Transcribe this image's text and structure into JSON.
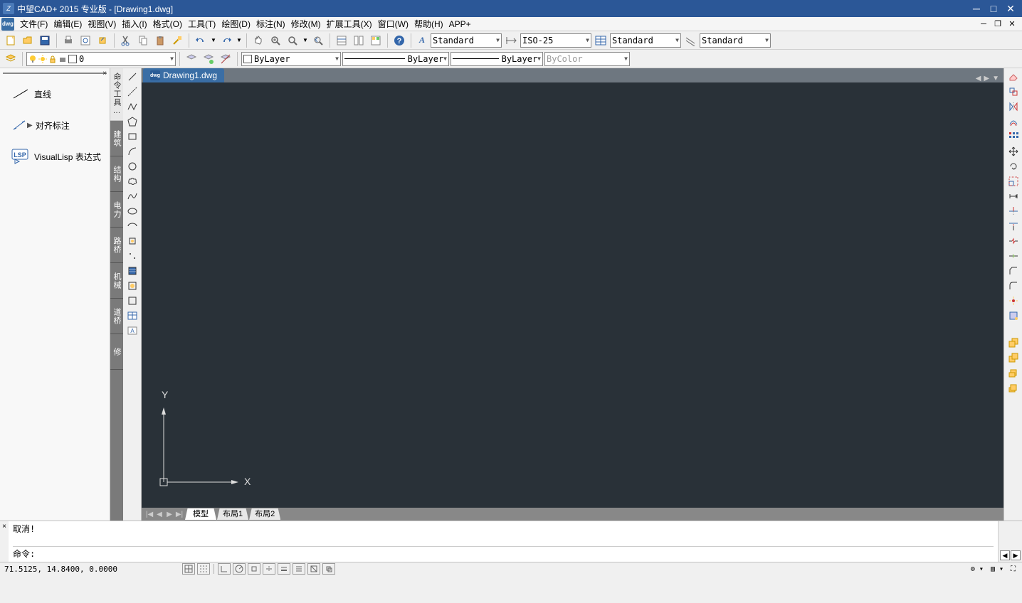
{
  "title": "中望CAD+ 2015 专业版 - [Drawing1.dwg]",
  "menus": [
    "文件(F)",
    "编辑(E)",
    "视图(V)",
    "插入(I)",
    "格式(O)",
    "工具(T)",
    "绘图(D)",
    "标注(N)",
    "修改(M)",
    "扩展工具(X)",
    "窗口(W)",
    "帮助(H)",
    "APP+"
  ],
  "row1_dropdowns": {
    "text_style": "Standard",
    "dim_style": "ISO-25",
    "table_style": "Standard",
    "mline_style": "Standard"
  },
  "layer_dropdown": "0",
  "row2_dropdowns": {
    "color": "ByLayer",
    "linetype": "ByLayer",
    "lineweight": "ByLayer",
    "plot_style": "ByColor"
  },
  "left_panel": {
    "items": [
      {
        "label": "直线"
      },
      {
        "label": "对齐标注"
      },
      {
        "label": "VisualLisp 表达式"
      }
    ]
  },
  "vtabs": [
    "命令工具…",
    "建筑",
    "结构",
    "电力",
    "路桥",
    "机械",
    "道桥",
    "修"
  ],
  "doc_tab": "Drawing1.dwg",
  "view_tabs": [
    "模型",
    "布局1",
    "布局2"
  ],
  "cmd_cancel": "取消!",
  "cmd_prompt": "命令:",
  "coords": "71.5125,  14.8400, 0.0000",
  "ucs": {
    "x": "X",
    "y": "Y"
  }
}
